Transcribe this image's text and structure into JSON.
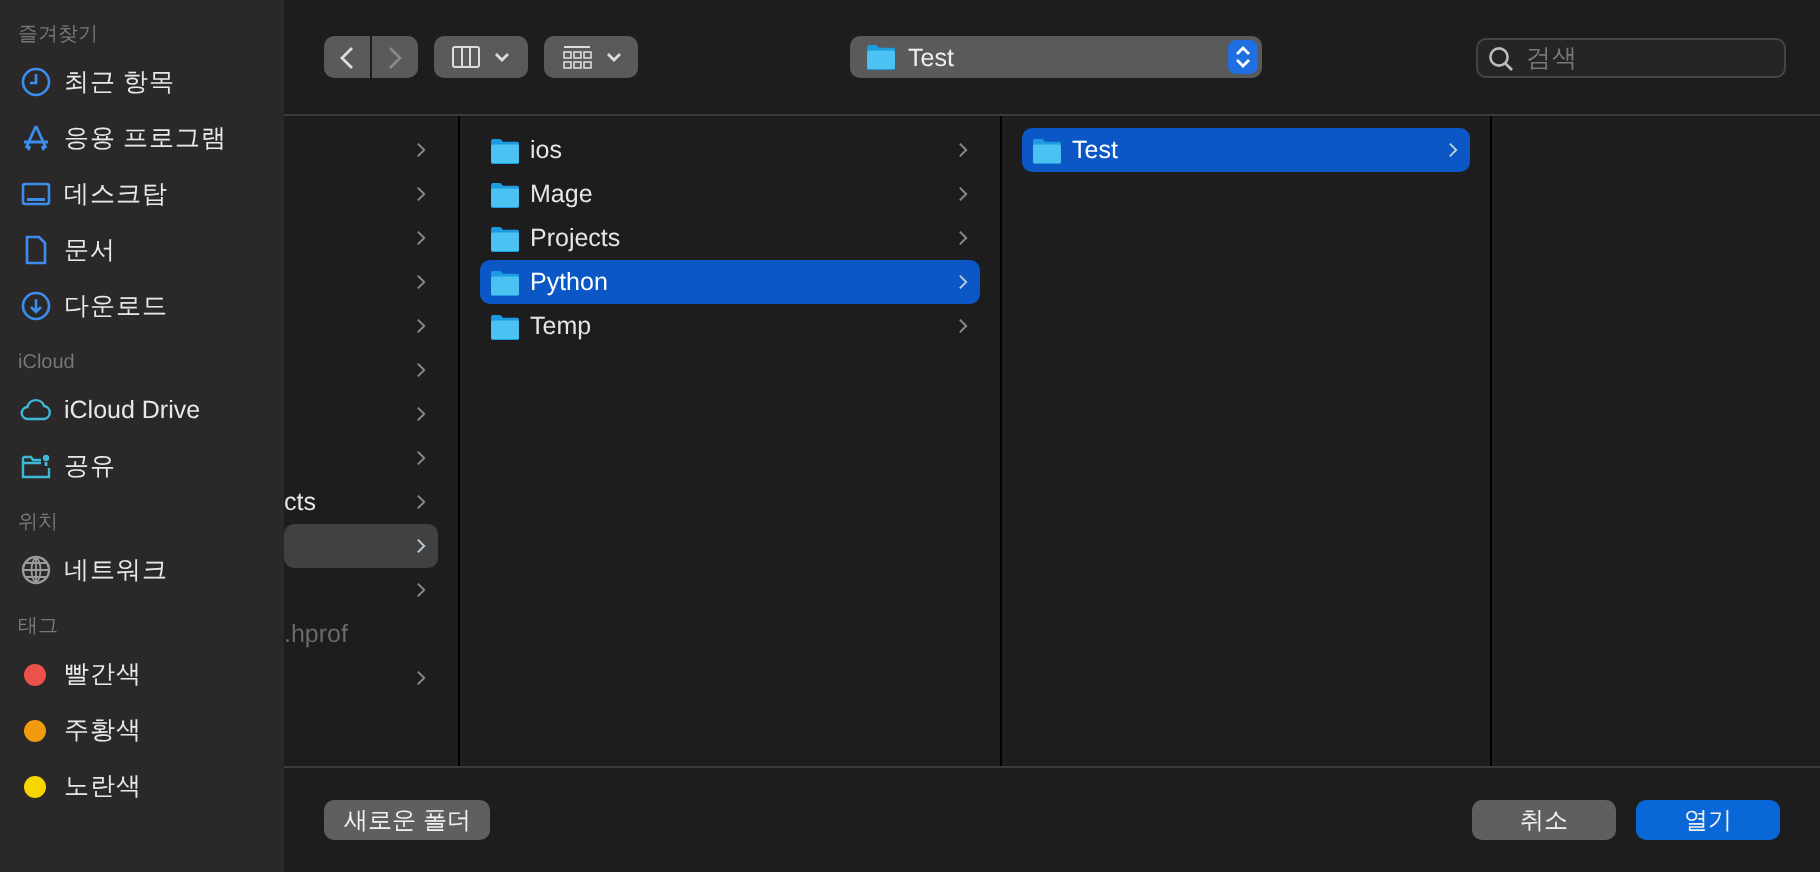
{
  "sidebar": {
    "sections": [
      {
        "heading": "즐겨찾기",
        "items": [
          {
            "kind": "recents",
            "label": "최근 항목"
          },
          {
            "kind": "apps",
            "label": "응용 프로그램"
          },
          {
            "kind": "desktop",
            "label": "데스크탑"
          },
          {
            "kind": "document",
            "label": "문서"
          },
          {
            "kind": "downloads",
            "label": "다운로드"
          }
        ]
      },
      {
        "heading": "iCloud",
        "items": [
          {
            "kind": "cloud",
            "label": "iCloud Drive"
          },
          {
            "kind": "shared",
            "label": "공유"
          }
        ]
      },
      {
        "heading": "위치",
        "items": [
          {
            "kind": "network",
            "label": "네트워크"
          }
        ]
      },
      {
        "heading": "태그",
        "items": [
          {
            "kind": "tag",
            "label": "빨간색",
            "color": "#ec524b"
          },
          {
            "kind": "tag",
            "label": "주황색",
            "color": "#f29b0f"
          },
          {
            "kind": "tag",
            "label": "노란색",
            "color": "#f7d500"
          }
        ]
      }
    ]
  },
  "toolbar": {
    "path": "Test",
    "search": {
      "placeholder": "검색"
    }
  },
  "columns": [
    [
      {
        "kind": "folder",
        "selected": false
      },
      {
        "kind": "folder",
        "selected": false
      },
      {
        "kind": "folder",
        "selected": false
      },
      {
        "kind": "folder",
        "selected": false
      },
      {
        "kind": "folder",
        "selected": false
      },
      {
        "kind": "folder",
        "selected": false
      },
      {
        "kind": "folder",
        "selected": false
      },
      {
        "kind": "folder",
        "selected": false
      },
      {
        "kind": "folder",
        "label": "cts",
        "selected": false
      },
      {
        "kind": "folder",
        "selected": true
      },
      {
        "kind": "folder",
        "selected": false
      },
      {
        "kind": "file",
        "label": ".hprof",
        "selected": false
      },
      {
        "kind": "folder",
        "selected": false
      }
    ],
    [
      {
        "kind": "folder",
        "label": "ios",
        "selected": false
      },
      {
        "kind": "folder",
        "label": "Mage",
        "selected": false
      },
      {
        "kind": "folder",
        "label": "Projects",
        "selected": false
      },
      {
        "kind": "folder",
        "label": "Python",
        "selected": true
      },
      {
        "kind": "folder",
        "label": "Temp",
        "selected": false
      }
    ],
    [
      {
        "kind": "folder",
        "label": "Test",
        "selected": true
      }
    ],
    []
  ],
  "buttons": {
    "new_folder": "새로운 폴더",
    "cancel": "취소",
    "open": "열기"
  }
}
